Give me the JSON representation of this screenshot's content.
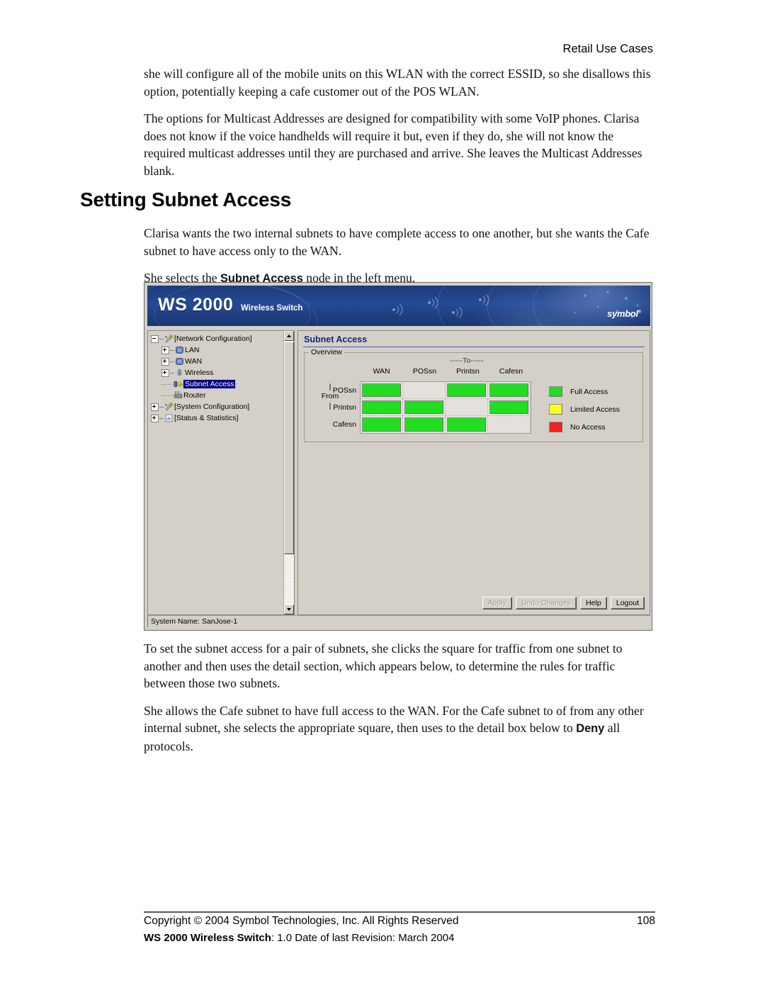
{
  "page": {
    "running_header": "Retail Use Cases",
    "page_number": "108"
  },
  "body": {
    "para_1": "she will configure all of the mobile units on this WLAN with the correct ESSID, so she disallows this option, potentially keeping a cafe customer out of the POS WLAN.",
    "para_2": "The options for Multicast Addresses are designed for compatibility with some VoIP phones. Clarisa does not know if the voice handhelds will require it but, even if they do, she will not know the required multicast addresses until they are purchased and arrive. She leaves the Multicast Addresses blank.",
    "section_title": "Setting Subnet Access",
    "para_3": "Clarisa wants the two internal subnets to have complete access to one another, but she wants the Cafe subnet to have access only to the WAN.",
    "para_4_prefix": "She selects the ",
    "para_4_bold": "Subnet Access",
    "para_4_suffix": " node in the left menu.",
    "para_5": "To set the subnet access for a pair of subnets, she clicks the square for traffic from one subnet to another and then uses the detail section, which appears below, to determine the rules for traffic between those two subnets.",
    "para_6_prefix": "She allows the Cafe subnet to have full access to the WAN. For the Cafe subnet to of from any other internal subnet, she selects the appropriate square, then uses to the detail box below to ",
    "para_6_bold": "Deny",
    "para_6_suffix": " all protocols."
  },
  "footer": {
    "copyright": "Copyright © 2004 Symbol Technologies, Inc. All Rights Reserved",
    "product_bold": "WS 2000 Wireless Switch",
    "product_rest": ": 1.0  Date of last Revision: March 2004"
  },
  "app": {
    "banner": {
      "product": "WS 2000",
      "subtitle": "Wireless Switch",
      "logo": "symbol"
    },
    "tree": {
      "items": [
        {
          "label": "[Network Configuration]",
          "level": 1,
          "expander": "minus",
          "icon": "network-config-icon",
          "selected": false
        },
        {
          "label": "LAN",
          "level": 2,
          "expander": "plus",
          "icon": "lan-icon",
          "selected": false
        },
        {
          "label": "WAN",
          "level": 2,
          "expander": "plus",
          "icon": "wan-icon",
          "selected": false
        },
        {
          "label": "Wireless",
          "level": 2,
          "expander": "plus",
          "icon": "wireless-icon",
          "selected": false
        },
        {
          "label": "Subnet Access",
          "level": 2,
          "expander": "none",
          "icon": "subnet-access-icon",
          "selected": true
        },
        {
          "label": "Router",
          "level": 2,
          "expander": "none",
          "icon": "router-icon",
          "selected": false
        },
        {
          "label": "[System Configuration]",
          "level": 1,
          "expander": "plus",
          "icon": "system-config-icon",
          "selected": false
        },
        {
          "label": "[Status & Statistics]",
          "level": 1,
          "expander": "plus",
          "icon": "status-stats-icon",
          "selected": false
        }
      ]
    },
    "panel": {
      "title": "Subnet Access",
      "groupbox_legend": "Overview",
      "to_label": "-----To-----",
      "from_label": "From",
      "from_bar": "|"
    },
    "matrix": {
      "columns": [
        "WAN",
        "POSsn",
        "Printsn",
        "Cafesn"
      ],
      "rows": [
        "POSsn",
        "Printsn",
        "Cafesn"
      ],
      "cells": [
        [
          "full",
          "none",
          "full",
          "full"
        ],
        [
          "full",
          "full",
          "none",
          "full"
        ],
        [
          "full",
          "full",
          "full",
          "none"
        ]
      ]
    },
    "legend": {
      "items": [
        {
          "label": "Full Access",
          "color": "#22DD22"
        },
        {
          "label": "Limited Access",
          "color": "#FFFF22"
        },
        {
          "label": "No Access",
          "color": "#F02222"
        }
      ]
    },
    "buttons": [
      {
        "label": "Apply",
        "disabled": true
      },
      {
        "label": "Undo Changes",
        "disabled": true
      },
      {
        "label": "Help",
        "disabled": false
      },
      {
        "label": "Logout",
        "disabled": false
      }
    ],
    "status": {
      "label": "System Name:",
      "value": "SanJose-1"
    }
  }
}
